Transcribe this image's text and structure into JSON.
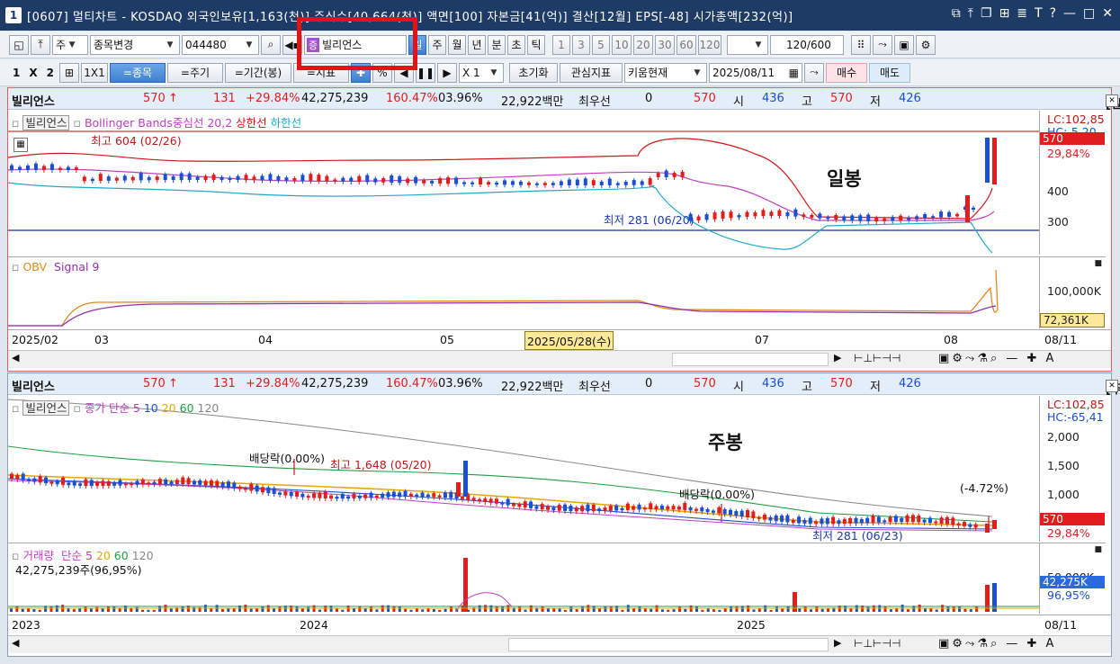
{
  "window": {
    "number": "1",
    "title": "[0607] 멀티차트 - KOSDAQ 외국인보유[1,163(천)] 주식수[40,664(천)] 액면[100] 자본금[41(억)] 결산[12월] EPS[-48] 시가총액[232(억)]",
    "controls": [
      "⧉",
      "⭱",
      "⧉",
      "⊞",
      "▤",
      "T",
      "?",
      "—",
      "□",
      "✕"
    ]
  },
  "toolbar1": {
    "type_label": "주",
    "stock_change_label": "종목변경",
    "code": "044480",
    "stock_name": "빌리언스",
    "stock_badge": "증",
    "periods": [
      "일",
      "주",
      "월",
      "년",
      "분",
      "초",
      "틱"
    ],
    "minute_steps": [
      "1",
      "3",
      "5",
      "10",
      "20",
      "30",
      "60",
      "120"
    ],
    "count": "120",
    "count_total": "/600"
  },
  "toolbar2": {
    "layout_1": "1",
    "layout_x": "X",
    "layout_2": "2",
    "layout_1x1": "1X1",
    "tabs": [
      "=종목",
      "=주기",
      "=기간(봉)",
      "=지표"
    ],
    "multiplier": "X 1",
    "reset": "초기화",
    "watch": "관심지표",
    "kiwoom": "키움현재",
    "date": "2025/08/11",
    "buy": "매수",
    "sell": "매도"
  },
  "info": {
    "name": "빌리언스",
    "price": "570",
    "arrow": "↑",
    "change": "131",
    "change_pct": "+29.84%",
    "volume": "42,275,239",
    "vol_ratio": "160.47%",
    "turnover": "03.96%",
    "amount": "22,922백만",
    "best_label": "최우선",
    "best_val": "0",
    "best_price": "570",
    "open_label": "시",
    "open": "436",
    "high_label": "고",
    "high": "570",
    "low_label": "저",
    "low": "426"
  },
  "daily": {
    "tag": "[일]",
    "legend_name": "빌리언스",
    "legend_ind": "Bollinger Bands중심선 20,2",
    "legend_upper": "상한선",
    "legend_lower": "하한선",
    "high_note": "최고 604 (02/26)",
    "low_note": "최저 281 (06/20)",
    "overlay": "일봉",
    "lc": "LC:102,85",
    "hc": "HC:-5,20",
    "last_price": "570",
    "last_pct": "29,84%",
    "y_ticks": [
      "400",
      "300"
    ],
    "obv_label": "OBV",
    "obv_signal": "Signal 9",
    "obv_tick": "100,000K",
    "obv_last": "72,361K",
    "x_labels": [
      "2025/02",
      "03",
      "04",
      "05",
      "07",
      "08"
    ],
    "x_cursor": "2025/05/28(수)",
    "x_right": "08/11"
  },
  "weekly": {
    "tag": "[주]",
    "legend_name": "빌리언스",
    "legend_ind": "종가 단순",
    "ma": [
      "5",
      "10",
      "20",
      "60",
      "120"
    ],
    "high_note": "최고 1,648 (05/20)",
    "low_note": "최저 281 (06/23)",
    "div1": "배당락(0.00%)",
    "div2": "배당락(0.00%)",
    "pct_note": "(-4.72%)",
    "overlay": "주봉",
    "lc": "LC:102,85",
    "hc": "HC:-65,41",
    "y_ticks": [
      "2,000",
      "1,500",
      "1,000"
    ],
    "last_price": "570",
    "last_pct": "29,84%",
    "vol_label": "거래량",
    "vol_ma": "단순",
    "vol_ma_vals": [
      "5",
      "20",
      "60",
      "120"
    ],
    "vol_value": "42,275,239주(96,95%)",
    "vol_tick": "50,000K",
    "vol_last": "42,275K",
    "vol_pct": "96,95%",
    "x_labels": [
      "2023",
      "2024",
      "2025"
    ],
    "x_right": "08/11"
  },
  "colors": {
    "up": "#e21d1d",
    "down": "#1a4fd0",
    "boll_mid": "#c040c0",
    "boll_up": "#d01818",
    "boll_low": "#20a8c8",
    "highlight_box": "#e41212"
  }
}
